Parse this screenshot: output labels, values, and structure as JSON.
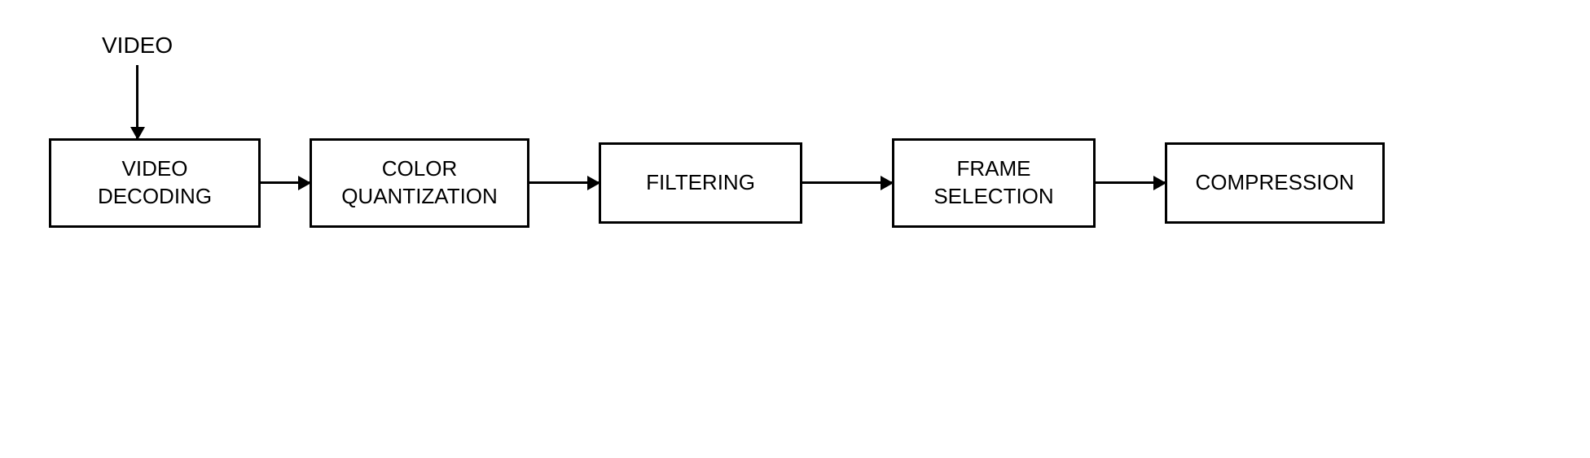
{
  "input_label": "VIDEO",
  "blocks": [
    {
      "label": "VIDEO\nDECODING"
    },
    {
      "label": "COLOR\nQUANTIZATION"
    },
    {
      "label": "FILTERING"
    },
    {
      "label": "FRAME\nSELECTION"
    },
    {
      "label": "COMPRESSION"
    }
  ]
}
